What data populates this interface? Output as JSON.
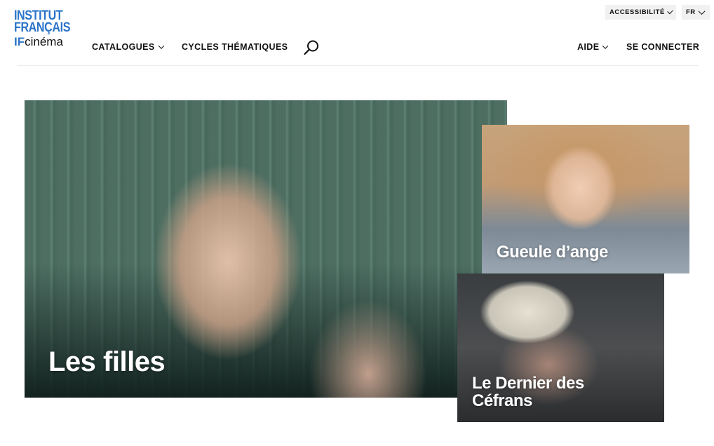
{
  "logo": {
    "line1": "INSTITUT",
    "line2": "FRANÇAIS",
    "if": "IF",
    "cinema": "cinéma"
  },
  "utility": {
    "accessibility": "ACCESSIBILITÉ",
    "language": "FR"
  },
  "nav": {
    "catalogues": "CATALOGUES",
    "cycles": "CYCLES THÉMATIQUES",
    "aide": "AIDE",
    "login": "SE CONNECTER"
  },
  "icons": {
    "search": "search-icon",
    "chevron": "chevron-down-icon"
  },
  "colors": {
    "brand": "#2b74c8"
  },
  "featured": [
    {
      "title": "Les filles"
    },
    {
      "title": "Gueule d’ange"
    },
    {
      "title": "Le Dernier des Céfrans"
    }
  ]
}
